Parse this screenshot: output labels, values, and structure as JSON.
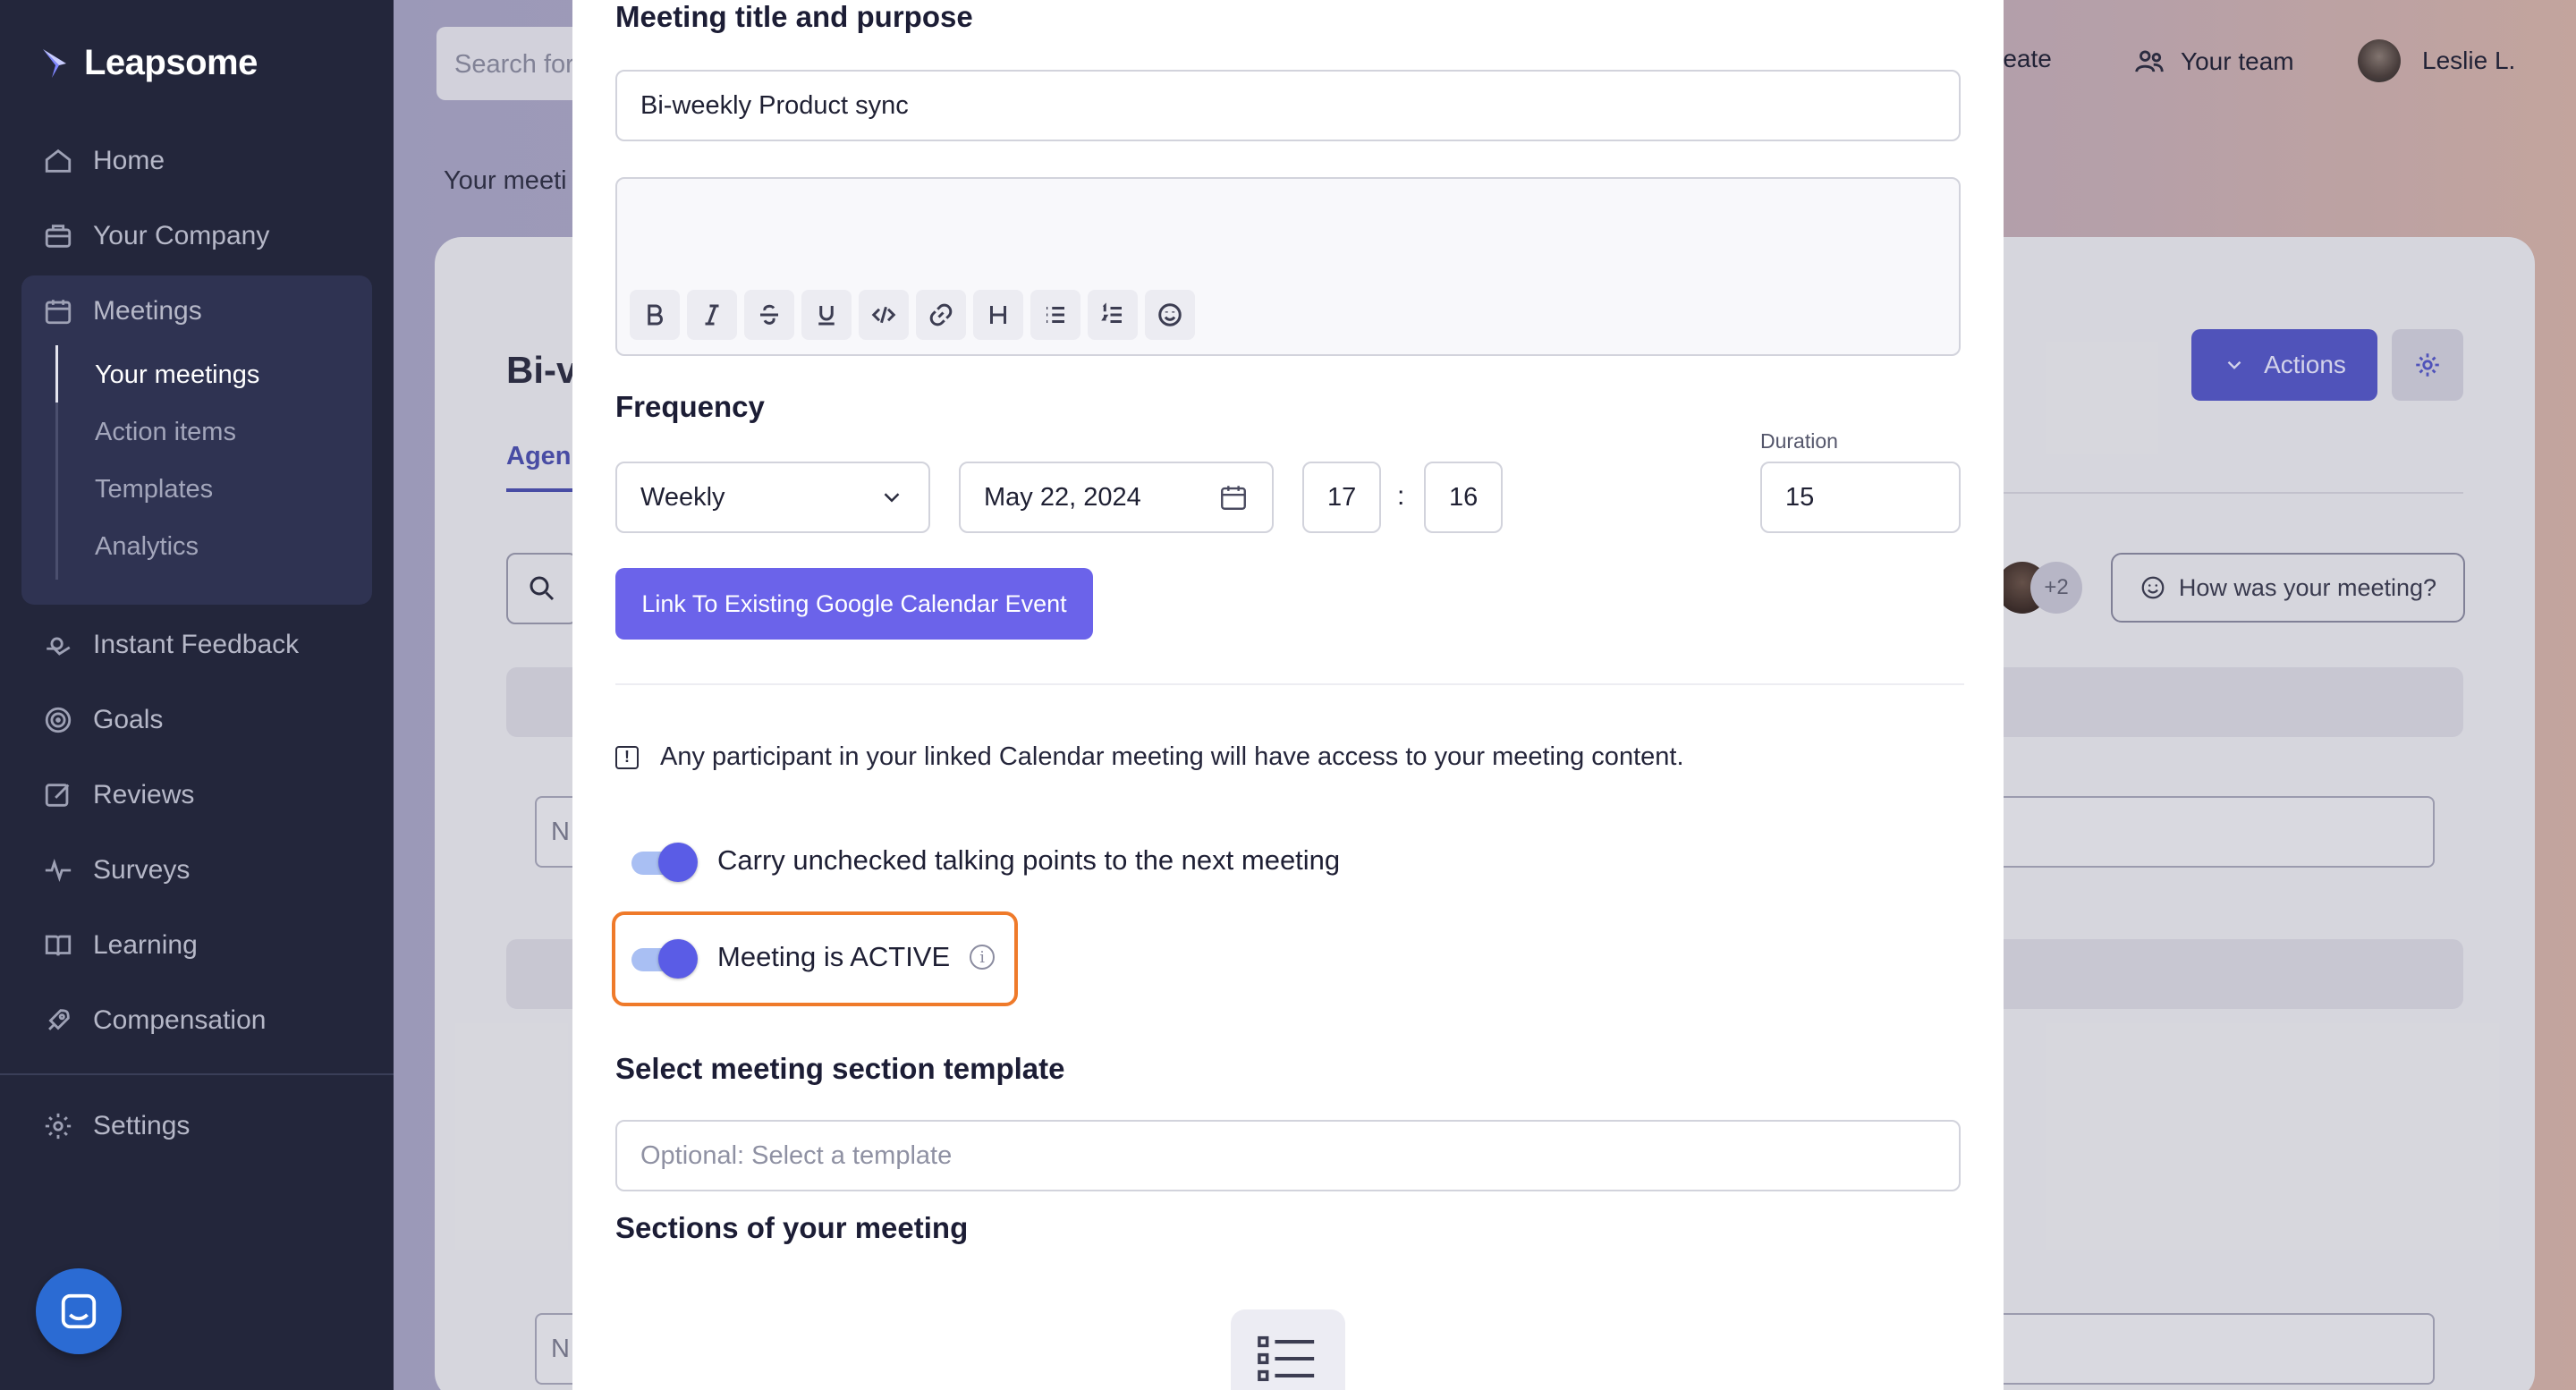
{
  "app": {
    "name": "Leapsome"
  },
  "sidebar": {
    "items": [
      {
        "label": "Home",
        "icon": "home-icon"
      },
      {
        "label": "Your Company",
        "icon": "briefcase-icon"
      },
      {
        "label": "Meetings",
        "icon": "calendar-icon"
      },
      {
        "label": "Instant Feedback",
        "icon": "feedback-icon"
      },
      {
        "label": "Goals",
        "icon": "target-icon"
      },
      {
        "label": "Reviews",
        "icon": "edit-icon"
      },
      {
        "label": "Surveys",
        "icon": "pulse-icon"
      },
      {
        "label": "Learning",
        "icon": "book-icon"
      },
      {
        "label": "Compensation",
        "icon": "rocket-icon"
      },
      {
        "label": "Settings",
        "icon": "gear-icon"
      }
    ],
    "meetings_sub": [
      "Your meetings",
      "Action items",
      "Templates",
      "Analytics"
    ]
  },
  "header": {
    "search_placeholder": "Search for",
    "create_label": "reate",
    "team_label": "Your team",
    "user_name": "Leslie L."
  },
  "background_page": {
    "breadcrumb": "Your meeti",
    "title": "Bi-v",
    "tab": "Agen",
    "actions_label": "Actions",
    "participants_more": "+2",
    "feedback_label": "How was your meeting?",
    "input_fragment": "N"
  },
  "modal": {
    "title_heading": "Meeting title and purpose",
    "title_value": "Bi-weekly Product sync",
    "frequency_heading": "Frequency",
    "frequency_value": "Weekly",
    "date_value": "May 22, 2024",
    "hour_value": "17",
    "time_separator": ":",
    "minute_value": "16",
    "duration_label": "Duration",
    "duration_value": "15",
    "link_calendar_label": "Link To Existing Google Calendar Event",
    "calendar_notice": "Any participant in your linked Calendar meeting will have access to your meeting content.",
    "carry_label": "Carry unchecked talking points to the next meeting",
    "active_label": "Meeting is ACTIVE",
    "template_heading": "Select meeting section template",
    "template_placeholder": "Optional: Select a template",
    "sections_heading": "Sections of your meeting"
  },
  "colors": {
    "sidebar": "#23263b",
    "accent": "#5a5ce6",
    "link_button": "#6b63ea",
    "highlight": "#ef7a2a"
  }
}
